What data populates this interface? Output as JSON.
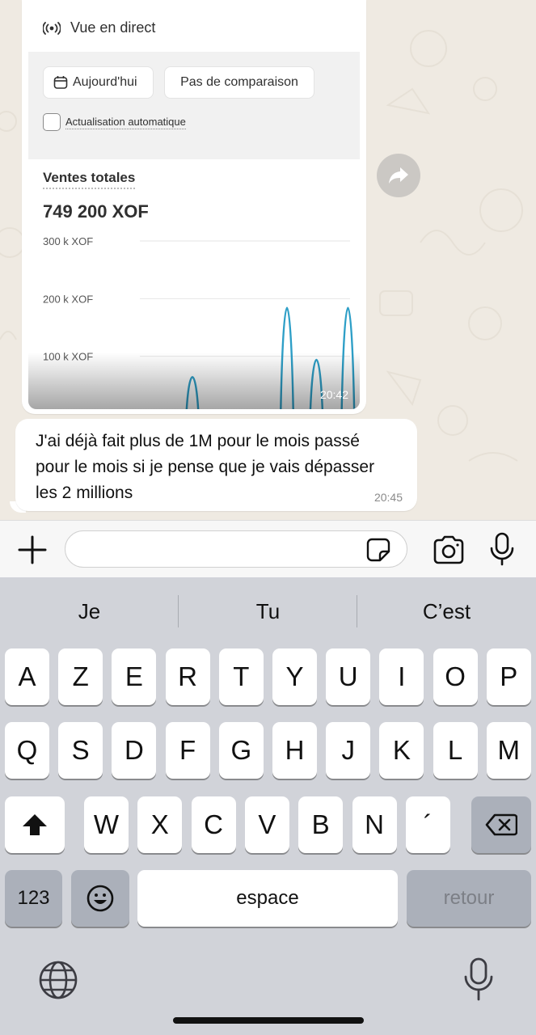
{
  "chat": {
    "image_message": {
      "live_label": "Vue en direct",
      "date_button": "Aujourd'hui",
      "compare_button": "Pas de comparaison",
      "auto_refresh_label": "Actualisation automatique",
      "sales_title": "Ventes totales",
      "sales_value": "749 200 XOF",
      "time": "20:42"
    },
    "text_message": {
      "text": "J'ai déjà fait plus de 1M pour le mois passé pour le mois si je pense que je vais dépasser les 2 millions",
      "time": "20:45"
    }
  },
  "chart_data": {
    "type": "line",
    "title": "Ventes totales",
    "y_ticks": [
      "300 k XOF",
      "200 k XOF",
      "100 k XOF"
    ],
    "ylim": [
      0,
      300000
    ],
    "grid": true,
    "peaks": [
      {
        "position": 0.25,
        "value": 90000
      },
      {
        "position": 0.7,
        "value": 250000
      },
      {
        "position": 0.84,
        "value": 130000
      },
      {
        "position": 0.99,
        "value": 250000
      }
    ]
  },
  "input_bar": {
    "placeholder": "",
    "value": ""
  },
  "keyboard": {
    "suggestions": [
      "Je",
      "Tu",
      "C’est"
    ],
    "row1": [
      "A",
      "Z",
      "E",
      "R",
      "T",
      "Y",
      "U",
      "I",
      "O",
      "P"
    ],
    "row2": [
      "Q",
      "S",
      "D",
      "F",
      "G",
      "H",
      "J",
      "K",
      "L",
      "M"
    ],
    "row3": [
      "W",
      "X",
      "C",
      "V",
      "B",
      "N",
      "´"
    ],
    "numbers_key": "123",
    "space_key": "espace",
    "return_key": "retour"
  },
  "colors": {
    "chat_background": "#efeae2",
    "chart_line": "#2e9fc7",
    "keyboard_background": "#d1d3d9"
  }
}
